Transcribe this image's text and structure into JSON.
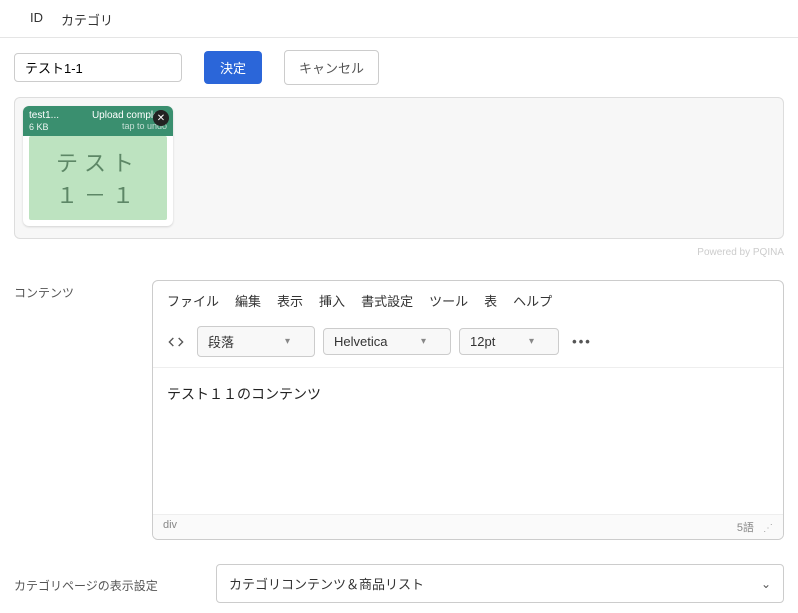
{
  "header": {
    "id_label": "ID",
    "category_label": "カテゴリ"
  },
  "actions": {
    "name_value": "テスト1-1",
    "submit_label": "決定",
    "cancel_label": "キャンセル"
  },
  "upload": {
    "file_name": "test1...",
    "file_size": "6 KB",
    "status": "Upload complete",
    "undo": "tap to undo",
    "thumb_line1": "テスト",
    "thumb_line2": "１－１",
    "powered": "Powered by PQINA"
  },
  "editor": {
    "label": "コンテンツ",
    "menubar": [
      "ファイル",
      "編集",
      "表示",
      "挿入",
      "書式設定",
      "ツール",
      "表",
      "ヘルプ"
    ],
    "block_format": "段落",
    "font_family": "Helvetica",
    "font_size": "12pt",
    "content": "テスト１１のコンテンツ",
    "status_path": "div",
    "word_count": "5語"
  },
  "display_setting": {
    "label": "カテゴリページの表示設定",
    "value": "カテゴリコンテンツ＆商品リスト"
  }
}
